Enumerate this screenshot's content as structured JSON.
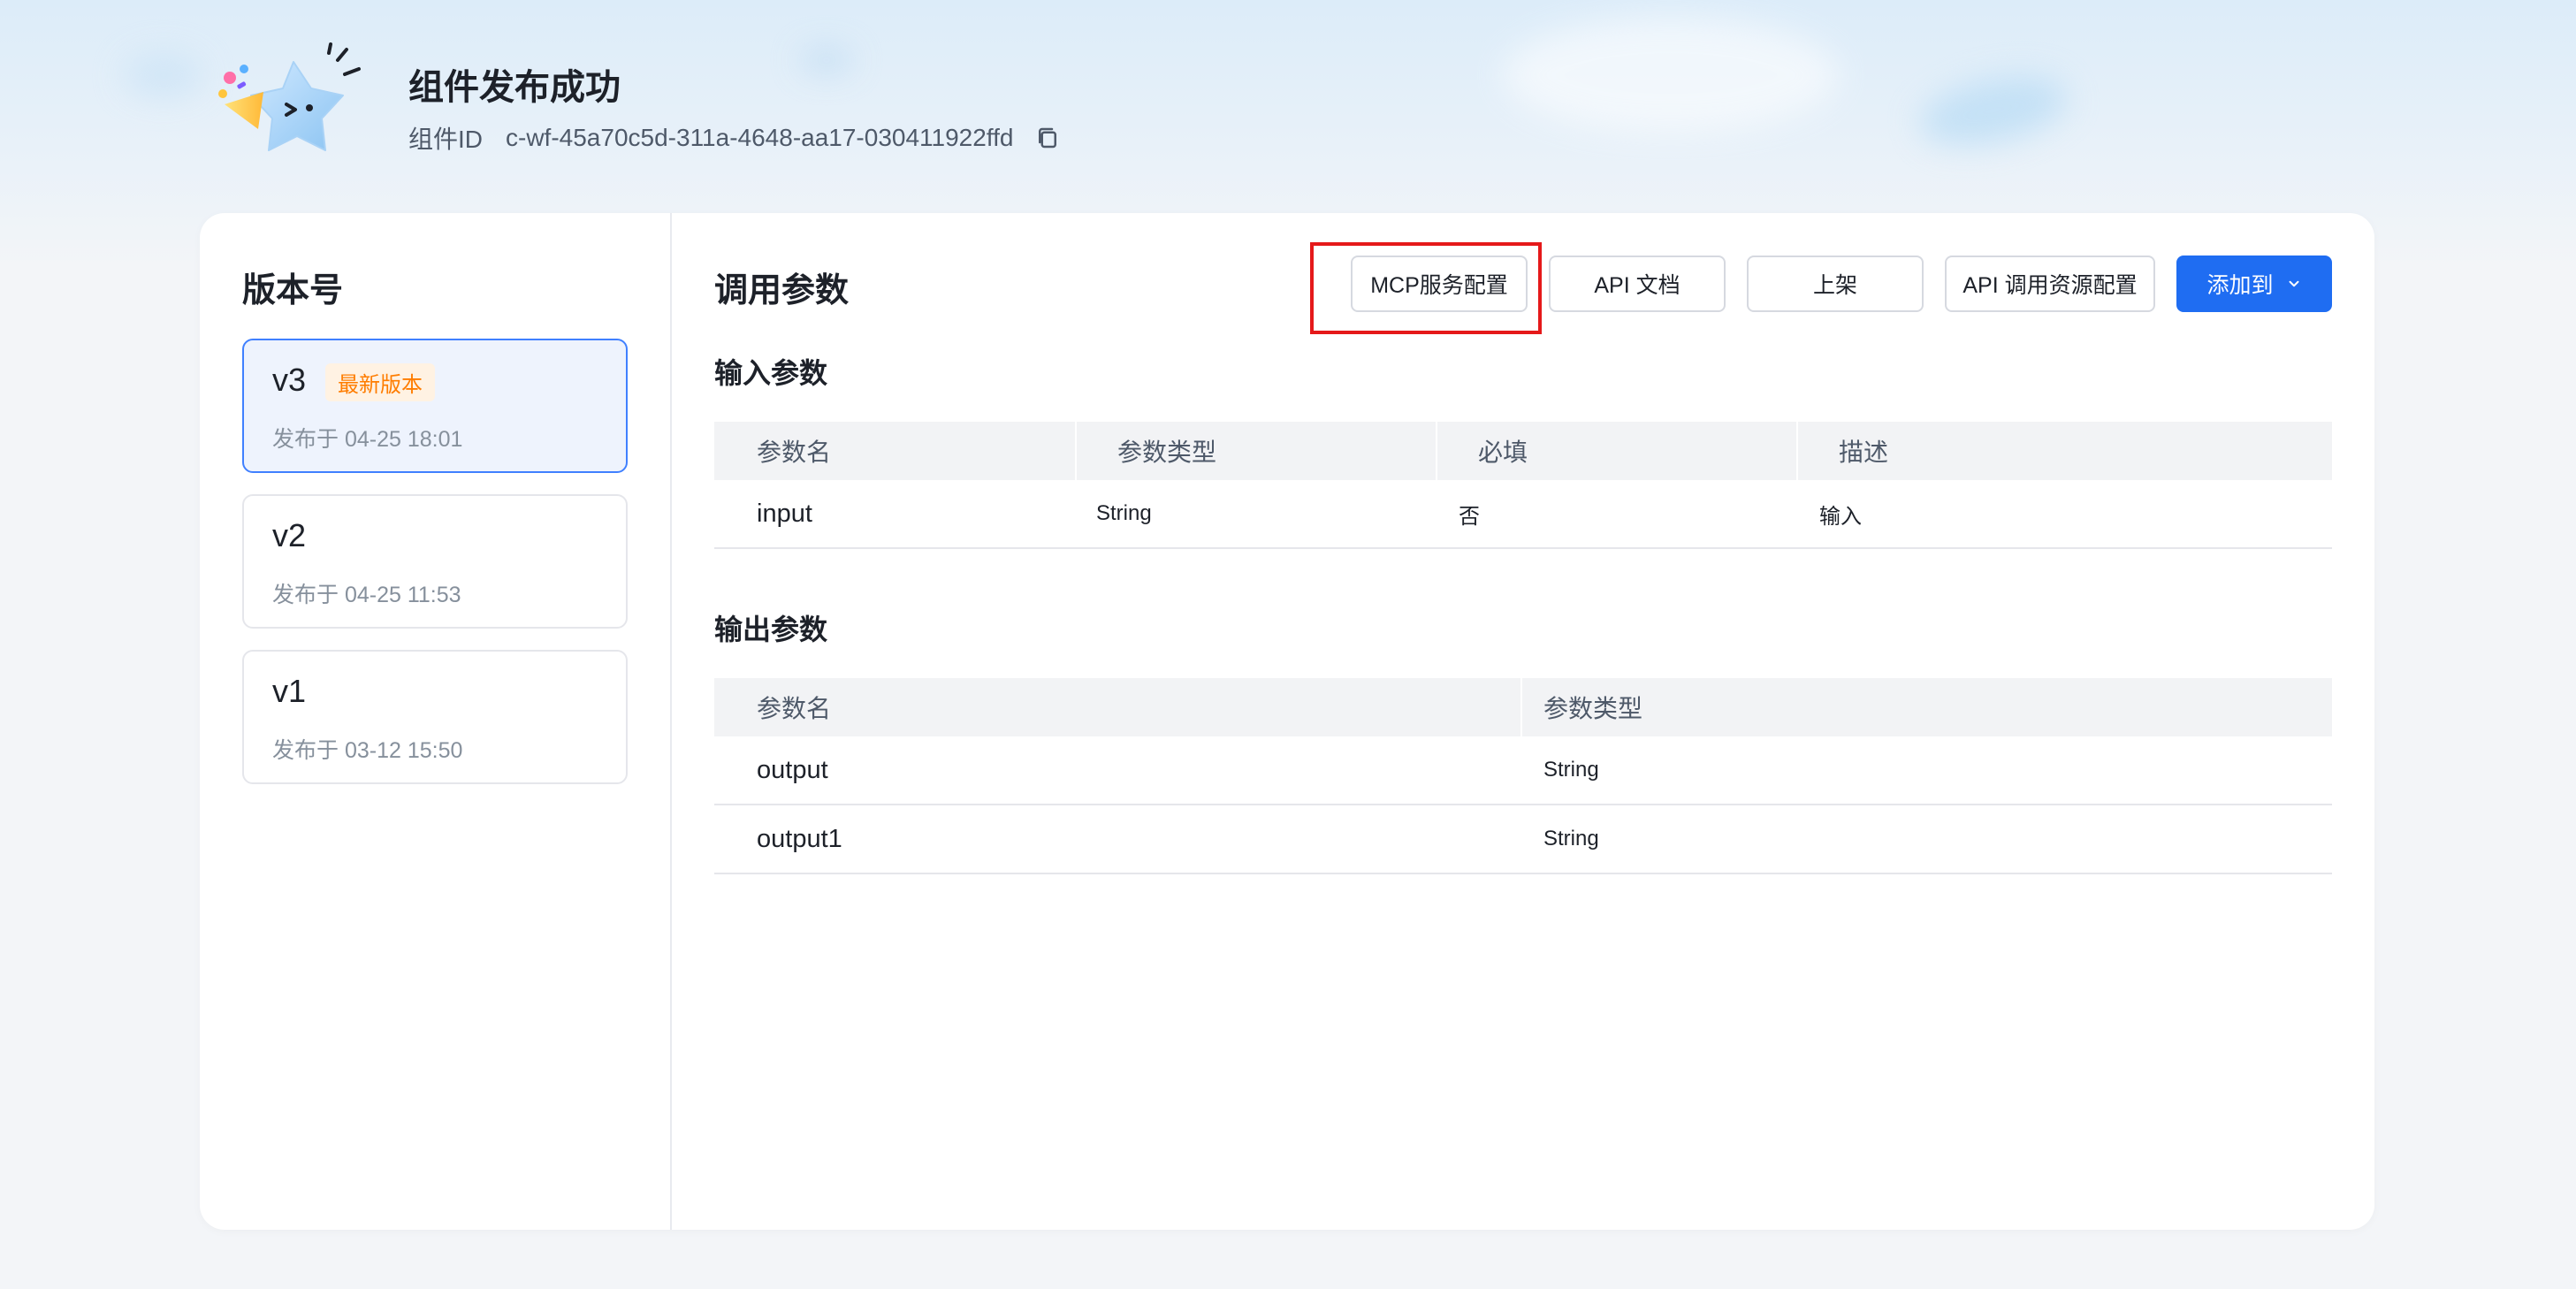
{
  "header": {
    "title": "组件发布成功",
    "id_label": "组件ID",
    "id_value": "c-wf-45a70c5d-311a-4648-aa17-030411922ffd"
  },
  "sidebar": {
    "title": "版本号",
    "versions": [
      {
        "name": "v3",
        "badge": "最新版本",
        "date": "发布于 04-25 18:01",
        "selected": true
      },
      {
        "name": "v2",
        "date": "发布于 04-25 11:53",
        "selected": false
      },
      {
        "name": "v1",
        "date": "发布于 03-12 15:50",
        "selected": false
      }
    ]
  },
  "main": {
    "title": "调用参数",
    "toolbar": {
      "mcp_label": "MCP服务配置",
      "api_doc_label": "API 文档",
      "publish_label": "上架",
      "api_resource_label": "API 调用资源配置",
      "add_to_label": "添加到"
    },
    "input_section": {
      "title": "输入参数",
      "headers": [
        "参数名",
        "参数类型",
        "必填",
        "描述"
      ],
      "rows": [
        [
          "input",
          "String",
          "否",
          "输入"
        ]
      ]
    },
    "output_section": {
      "title": "输出参数",
      "headers": [
        "参数名",
        "参数类型"
      ],
      "rows": [
        [
          "output",
          "String"
        ],
        [
          "output1",
          "String"
        ]
      ]
    }
  },
  "colors": {
    "primary": "#1f6df2",
    "selected_border": "#4080ff",
    "badge_text": "#ff7d00",
    "highlight_box": "#e5191a"
  },
  "icons": [
    "party-star-mascot-icon",
    "copy-icon",
    "chevron-down-icon"
  ]
}
